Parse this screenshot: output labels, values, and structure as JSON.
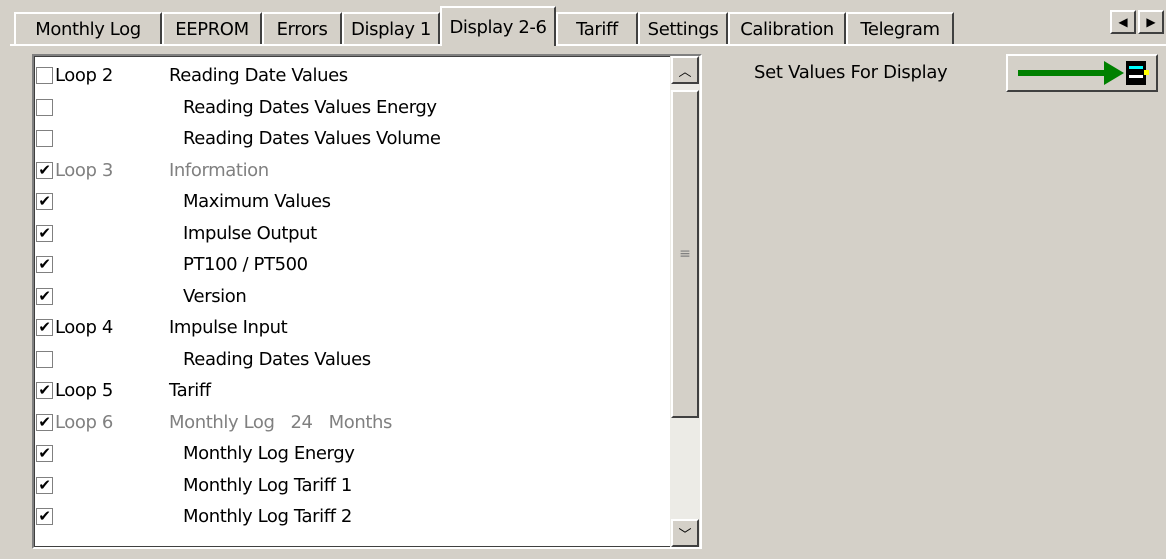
{
  "tabs": [
    {
      "label": "Monthly Log"
    },
    {
      "label": "EEPROM"
    },
    {
      "label": "Errors"
    },
    {
      "label": "Display 1"
    },
    {
      "label": "Display 2-6"
    },
    {
      "label": "Tariff"
    },
    {
      "label": "Settings"
    },
    {
      "label": "Calibration"
    },
    {
      "label": "Telegram"
    }
  ],
  "active_tab": "Display 2-6",
  "tab_scroll": {
    "left_icon": "arrow-left-icon",
    "right_icon": "arrow-right-icon",
    "left_glyph": "◀",
    "right_glyph": "▶"
  },
  "list": {
    "check_glyph": "✔",
    "items": [
      {
        "loop": "Loop 2",
        "text": "Reading Date Values",
        "checked": false,
        "gray": false
      },
      {
        "loop": "",
        "text": "Reading Dates Values Energy",
        "checked": false,
        "gray": false
      },
      {
        "loop": "",
        "text": "Reading Dates Values Volume",
        "checked": false,
        "gray": false
      },
      {
        "loop": "Loop 3",
        "text": "Information",
        "checked": true,
        "gray": true
      },
      {
        "loop": "",
        "text": "Maximum Values",
        "checked": true,
        "gray": false
      },
      {
        "loop": "",
        "text": "Impulse Output",
        "checked": true,
        "gray": false
      },
      {
        "loop": "",
        "text": "PT100 / PT500",
        "checked": true,
        "gray": false
      },
      {
        "loop": "",
        "text": "Version",
        "checked": true,
        "gray": false
      },
      {
        "loop": "Loop 4",
        "text": "Impulse Input",
        "checked": true,
        "gray": false
      },
      {
        "loop": "",
        "text": "Reading Dates Values",
        "checked": false,
        "gray": false
      },
      {
        "loop": "Loop 5",
        "text": "Tariff",
        "checked": true,
        "gray": false
      },
      {
        "loop": "Loop 6",
        "text": "Monthly Log   24   Months",
        "checked": true,
        "gray": true
      },
      {
        "loop": "",
        "text": "Monthly Log Energy",
        "checked": true,
        "gray": false
      },
      {
        "loop": "",
        "text": "Monthly Log Tariff 1",
        "checked": true,
        "gray": false
      },
      {
        "loop": "",
        "text": "Monthly Log Tariff 2",
        "checked": true,
        "gray": false
      }
    ]
  },
  "scrollbar": {
    "up_icon": "chevron-up-icon",
    "down_icon": "chevron-down-icon",
    "grip_icon": "grip-icon",
    "up_glyph": "︿",
    "down_glyph": "﹀",
    "grip_glyph": "≡"
  },
  "set_values": {
    "label": "Set Values For Display",
    "button_icon": "arrow-to-display-icon",
    "arrow_color": "#008000",
    "display_icon_colors": [
      "#000000",
      "#00ffff",
      "#ffff00"
    ]
  }
}
